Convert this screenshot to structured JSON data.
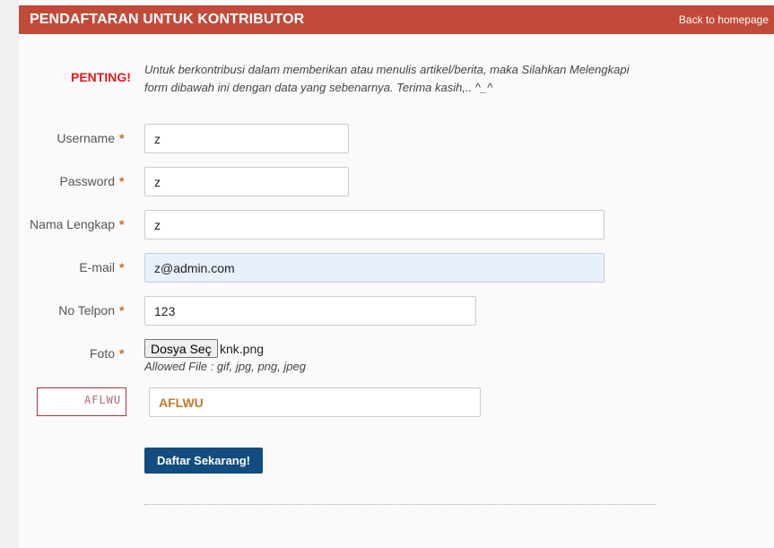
{
  "header": {
    "title": "PENDAFTARAN UNTUK KONTRIBUTOR",
    "back_link": "Back to homepage"
  },
  "notice": {
    "label": "PENTING!",
    "line1": "Untuk berkontribusi dalam memberikan atau menulis artikel/berita, maka Silahkan Melengkapi",
    "line2": "form dibawah ini dengan data yang sebenarnya. Terima kasih,.. ^_^"
  },
  "required_mark": "*",
  "form": {
    "username": {
      "label": "Username",
      "value": "z"
    },
    "password": {
      "label": "Password",
      "value": "z"
    },
    "full_name": {
      "label": "Nama Lengkap",
      "value": "z"
    },
    "email": {
      "label": "E-mail",
      "value": "z@admin.com"
    },
    "phone": {
      "label": "No Telpon",
      "value": "123"
    },
    "photo": {
      "label": "Foto",
      "button_label": "Dosya Seç",
      "file_name": "knk.png",
      "hint": "Allowed File : gif, jpg, png, jpeg"
    },
    "captcha": {
      "image_text": "AFLWU",
      "value": "AFLWU"
    },
    "submit_label": "Daftar Sekarang!"
  },
  "colors": {
    "header_bg": "#c14a38",
    "notice": "#e21c1c",
    "required": "#c0702a",
    "submit_bg": "#114d7e",
    "autofill_bg": "#e8f0fe"
  }
}
